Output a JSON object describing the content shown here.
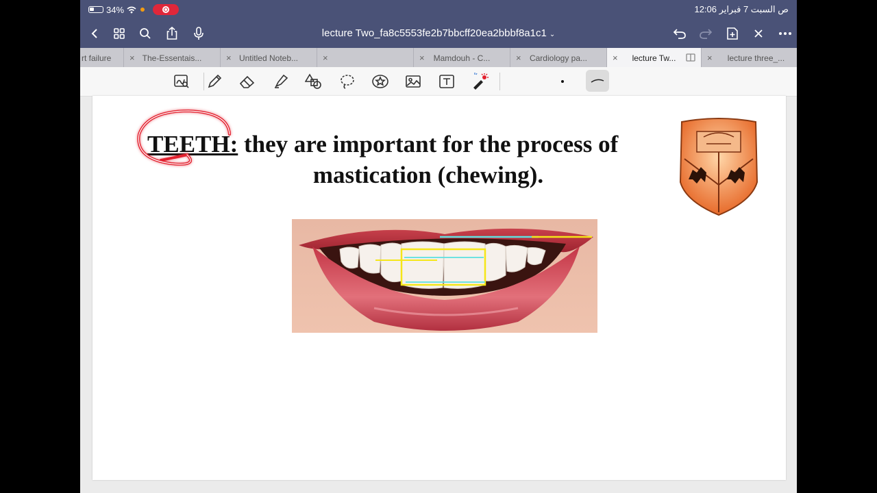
{
  "status": {
    "battery": "34%",
    "time_date": "12:06 ص  السبت 7 فبراير"
  },
  "title_bar": {
    "doc_title": "lecture Two_fa8c5553fe2b7bbcff20ea2bbbf8a1c1",
    "left_icons": [
      "back-icon",
      "grid-icon",
      "search-icon",
      "share-icon",
      "mic-icon"
    ],
    "right_icons": [
      "undo-icon",
      "redo-icon",
      "add-page-icon",
      "close-icon",
      "more-icon"
    ]
  },
  "tabs": [
    {
      "label": "rt failure",
      "active": false
    },
    {
      "label": "The-Essentais...",
      "active": false
    },
    {
      "label": "Untitled Noteb...",
      "active": false
    },
    {
      "label": "",
      "active": false
    },
    {
      "label": "Mamdouh - C...",
      "active": false
    },
    {
      "label": "Cardiology pa...",
      "active": false
    },
    {
      "label": "lecture Tw...",
      "active": true
    },
    {
      "label": "lecture three_...",
      "active": false
    }
  ],
  "toolbar": {
    "tools": [
      "zoom-window-icon",
      "pen-icon",
      "eraser-icon",
      "highlighter-icon",
      "shapes-icon",
      "lasso-icon",
      "sticker-icon",
      "image-icon",
      "text-icon",
      "laser-pointer-icon"
    ]
  },
  "page": {
    "heading_keyword": "TEETH:",
    "heading_line1_rest": " they are important for the process of",
    "heading_line2": "mastication (chewing).",
    "colors": {
      "annotation_red": "#e3212f",
      "annotation_yellow": "#f5e618",
      "annotation_cyan": "#5fe0e0",
      "crest_orange": "#f08a3c"
    }
  }
}
